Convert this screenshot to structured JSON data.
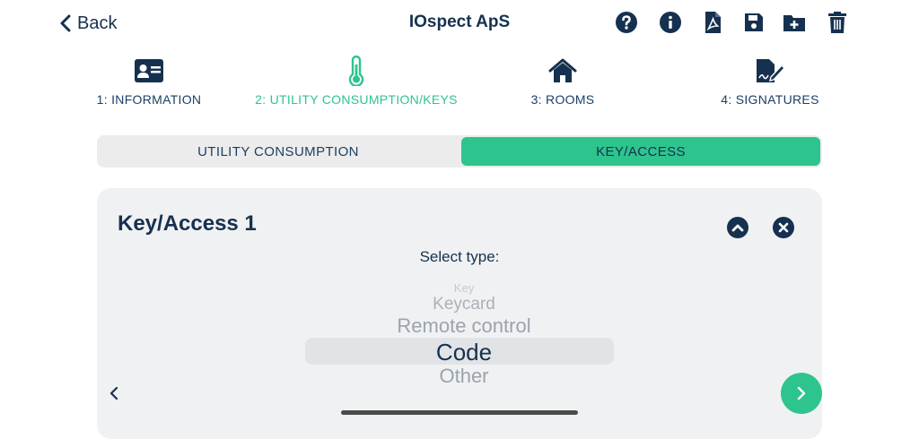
{
  "header": {
    "back_label": "Back",
    "title": "IOspect ApS",
    "icons": [
      "help-icon",
      "info-icon",
      "pdf-icon",
      "save-icon",
      "folder-add-icon",
      "trash-icon"
    ]
  },
  "steps": [
    {
      "label": "1: INFORMATION",
      "icon": "id-card-icon",
      "active": false
    },
    {
      "label": "2: UTILITY CONSUMPTION/KEYS",
      "icon": "thermometer-icon",
      "active": true
    },
    {
      "label": "3: ROOMS",
      "icon": "home-icon",
      "active": false
    },
    {
      "label": "4: SIGNATURES",
      "icon": "signature-icon",
      "active": false
    }
  ],
  "segments": {
    "utility": "UTILITY CONSUMPTION",
    "key_access": "KEY/ACCESS",
    "selected": "KEY/ACCESS"
  },
  "card": {
    "title": "Key/Access 1",
    "select_label": "Select type:",
    "options": [
      "Key",
      "Keycard",
      "Remote control",
      "Code",
      "Other"
    ],
    "selected": "Code"
  },
  "colors": {
    "accent": "#2ec48e",
    "primary": "#16314f",
    "card_bg": "#f0f1f3",
    "segment_bg": "#ececec"
  }
}
